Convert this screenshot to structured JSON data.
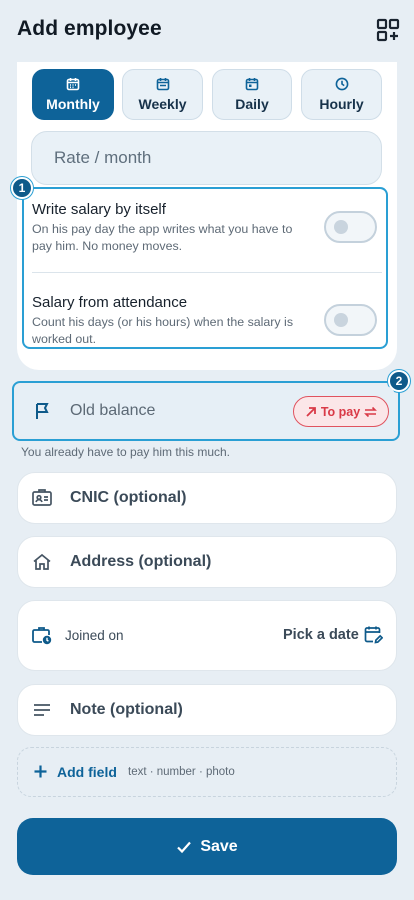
{
  "header": {
    "title": "Add employee",
    "qr_icon": "qr-add-icon"
  },
  "pay_period": {
    "tabs": [
      {
        "label": "Monthly",
        "icon": "calendar-icon",
        "active": true
      },
      {
        "label": "Weekly",
        "icon": "calendar-icon",
        "active": false
      },
      {
        "label": "Daily",
        "icon": "calendar-icon",
        "active": false
      },
      {
        "label": "Hourly",
        "icon": "clock-icon",
        "active": false
      }
    ]
  },
  "rate": {
    "placeholder": "Rate / month"
  },
  "annotations": {
    "badge1": "1",
    "badge2": "2"
  },
  "options": [
    {
      "title": "Write salary by itself",
      "desc": "On his pay day the app writes what you have to pay him. No money moves.",
      "on": false
    },
    {
      "title": "Salary from attendance",
      "desc": "Count his days (or his hours) when the salary is worked out.",
      "on": false
    }
  ],
  "balance": {
    "label": "Old balance",
    "direction": "To pay",
    "helper": "You already have to pay him this much."
  },
  "fields": {
    "cnic": "CNIC (optional)",
    "address": "Address (optional)",
    "joined_label": "Joined on",
    "joined_value": "Pick a date",
    "note": "Note (optional)"
  },
  "add_field": {
    "label": "Add field",
    "hint": "text · number · photo"
  },
  "save": {
    "label": "Save"
  },
  "colors": {
    "primary": "#0e6399",
    "highlight": "#2a9fd4",
    "danger": "#d93a47",
    "background": "#e7eef4"
  }
}
